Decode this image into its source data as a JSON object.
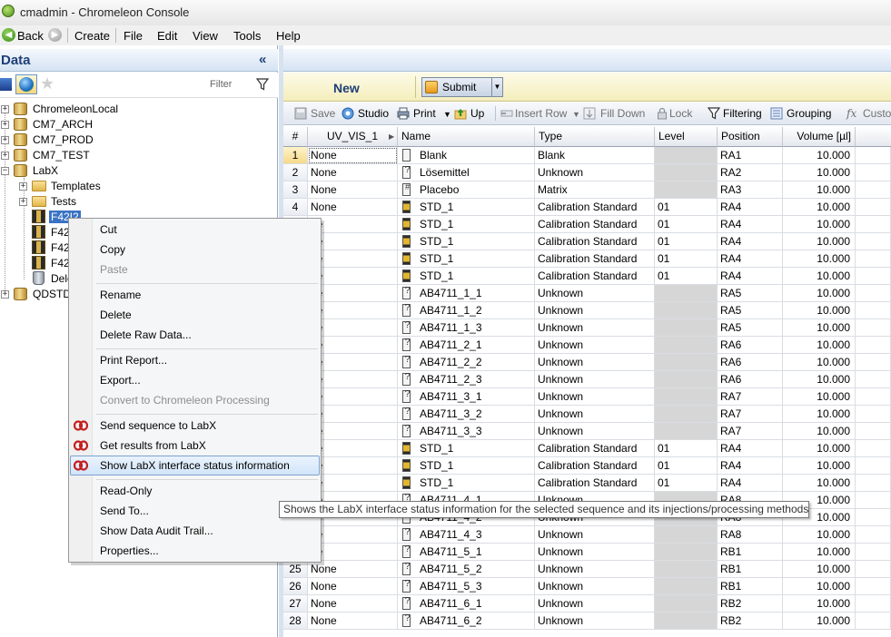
{
  "window": {
    "title": "cmadmin - Chromeleon Console"
  },
  "menubar": {
    "back_label": "Back",
    "items": [
      "Create",
      "File",
      "Edit",
      "View",
      "Tools",
      "Help"
    ]
  },
  "left_pane": {
    "title": "Data",
    "collapse_glyph": "«",
    "filter_label": "Filter",
    "tree": [
      {
        "label": "ChromeleonLocal"
      },
      {
        "label": "CM7_ARCH"
      },
      {
        "label": "CM7_PROD"
      },
      {
        "label": "CM7_TEST"
      },
      {
        "label": "LabX"
      },
      {
        "label": "Templates"
      },
      {
        "label": "Tests"
      },
      {
        "label": "F42I2"
      },
      {
        "label": "F42"
      },
      {
        "label": "F42"
      },
      {
        "label": "F42"
      },
      {
        "label": "Dele"
      },
      {
        "label": "QDSTD"
      }
    ]
  },
  "right_pane": {
    "new_label": "New",
    "submit_label": "Submit",
    "toolbar": {
      "save": "Save",
      "studio": "Studio",
      "print": "Print",
      "up": "Up",
      "insert_row": "Insert Row",
      "fill_down": "Fill Down",
      "lock": "Lock",
      "filtering": "Filtering",
      "grouping": "Grouping",
      "custom": "Custo"
    },
    "columns": [
      "#",
      "UV_VIS_1",
      "Name",
      "Type",
      "Level",
      "Position",
      "Volume [µl]"
    ],
    "rows": [
      {
        "n": "1",
        "uv": "None",
        "name": "Blank",
        "type": "Blank",
        "level": "",
        "pos": "RA1",
        "vol": "10.000",
        "kind": "blank"
      },
      {
        "n": "2",
        "uv": "None",
        "name": "Lösemittel",
        "type": "Unknown",
        "level": "",
        "pos": "RA2",
        "vol": "10.000",
        "kind": "unk"
      },
      {
        "n": "3",
        "uv": "None",
        "name": "Placebo",
        "type": "Matrix",
        "level": "",
        "pos": "RA3",
        "vol": "10.000",
        "kind": "mat"
      },
      {
        "n": "4",
        "uv": "None",
        "name": "STD_1",
        "type": "Calibration Standard",
        "level": "01",
        "pos": "RA4",
        "vol": "10.000",
        "kind": "std"
      },
      {
        "n": "",
        "uv": "ne",
        "name": "STD_1",
        "type": "Calibration Standard",
        "level": "01",
        "pos": "RA4",
        "vol": "10.000",
        "kind": "std"
      },
      {
        "n": "",
        "uv": "ne",
        "name": "STD_1",
        "type": "Calibration Standard",
        "level": "01",
        "pos": "RA4",
        "vol": "10.000",
        "kind": "std"
      },
      {
        "n": "",
        "uv": "ne",
        "name": "STD_1",
        "type": "Calibration Standard",
        "level": "01",
        "pos": "RA4",
        "vol": "10.000",
        "kind": "std"
      },
      {
        "n": "",
        "uv": "ne",
        "name": "STD_1",
        "type": "Calibration Standard",
        "level": "01",
        "pos": "RA4",
        "vol": "10.000",
        "kind": "std"
      },
      {
        "n": "",
        "uv": "ne",
        "name": "AB4711_1_1",
        "type": "Unknown",
        "level": "",
        "pos": "RA5",
        "vol": "10.000",
        "kind": "unk"
      },
      {
        "n": "",
        "uv": "ne",
        "name": "AB4711_1_2",
        "type": "Unknown",
        "level": "",
        "pos": "RA5",
        "vol": "10.000",
        "kind": "unk"
      },
      {
        "n": "",
        "uv": "ne",
        "name": "AB4711_1_3",
        "type": "Unknown",
        "level": "",
        "pos": "RA5",
        "vol": "10.000",
        "kind": "unk"
      },
      {
        "n": "",
        "uv": "ne",
        "name": "AB4711_2_1",
        "type": "Unknown",
        "level": "",
        "pos": "RA6",
        "vol": "10.000",
        "kind": "unk"
      },
      {
        "n": "",
        "uv": "ne",
        "name": "AB4711_2_2",
        "type": "Unknown",
        "level": "",
        "pos": "RA6",
        "vol": "10.000",
        "kind": "unk"
      },
      {
        "n": "",
        "uv": "ne",
        "name": "AB4711_2_3",
        "type": "Unknown",
        "level": "",
        "pos": "RA6",
        "vol": "10.000",
        "kind": "unk"
      },
      {
        "n": "",
        "uv": "ne",
        "name": "AB4711_3_1",
        "type": "Unknown",
        "level": "",
        "pos": "RA7",
        "vol": "10.000",
        "kind": "unk"
      },
      {
        "n": "",
        "uv": "ne",
        "name": "AB4711_3_2",
        "type": "Unknown",
        "level": "",
        "pos": "RA7",
        "vol": "10.000",
        "kind": "unk"
      },
      {
        "n": "",
        "uv": "ne",
        "name": "AB4711_3_3",
        "type": "Unknown",
        "level": "",
        "pos": "RA7",
        "vol": "10.000",
        "kind": "unk"
      },
      {
        "n": "",
        "uv": "ne",
        "name": "STD_1",
        "type": "Calibration Standard",
        "level": "01",
        "pos": "RA4",
        "vol": "10.000",
        "kind": "std"
      },
      {
        "n": "",
        "uv": "ne",
        "name": "STD_1",
        "type": "Calibration Standard",
        "level": "01",
        "pos": "RA4",
        "vol": "10.000",
        "kind": "std"
      },
      {
        "n": "",
        "uv": "ne",
        "name": "STD_1",
        "type": "Calibration Standard",
        "level": "01",
        "pos": "RA4",
        "vol": "10.000",
        "kind": "std"
      },
      {
        "n": "",
        "uv": "ne",
        "name": "AB4711_4_1",
        "type": "Unknown",
        "level": "",
        "pos": "RA8",
        "vol": "10.000",
        "kind": "unk"
      },
      {
        "n": "",
        "uv": "ne",
        "name": "AB4711_4_2",
        "type": "Unknown",
        "level": "",
        "pos": "RA8",
        "vol": "10.000",
        "kind": "unk"
      },
      {
        "n": "",
        "uv": "ne",
        "name": "AB4711_4_3",
        "type": "Unknown",
        "level": "",
        "pos": "RA8",
        "vol": "10.000",
        "kind": "unk"
      },
      {
        "n": "",
        "uv": "ne",
        "name": "AB4711_5_1",
        "type": "Unknown",
        "level": "",
        "pos": "RB1",
        "vol": "10.000",
        "kind": "unk"
      },
      {
        "n": "25",
        "uv": "None",
        "name": "AB4711_5_2",
        "type": "Unknown",
        "level": "",
        "pos": "RB1",
        "vol": "10.000",
        "kind": "unk"
      },
      {
        "n": "26",
        "uv": "None",
        "name": "AB4711_5_3",
        "type": "Unknown",
        "level": "",
        "pos": "RB1",
        "vol": "10.000",
        "kind": "unk"
      },
      {
        "n": "27",
        "uv": "None",
        "name": "AB4711_6_1",
        "type": "Unknown",
        "level": "",
        "pos": "RB2",
        "vol": "10.000",
        "kind": "unk"
      },
      {
        "n": "28",
        "uv": "None",
        "name": "AB4711_6_2",
        "type": "Unknown",
        "level": "",
        "pos": "RB2",
        "vol": "10.000",
        "kind": "unk"
      }
    ]
  },
  "context_menu": {
    "items": [
      {
        "label": "Cut",
        "enabled": true
      },
      {
        "label": "Copy",
        "enabled": true
      },
      {
        "label": "Paste",
        "enabled": false
      },
      {
        "label": "Rename",
        "enabled": true
      },
      {
        "label": "Delete",
        "enabled": true
      },
      {
        "label": "Delete Raw Data...",
        "enabled": true
      },
      {
        "label": "Print Report...",
        "enabled": true
      },
      {
        "label": "Export...",
        "enabled": true
      },
      {
        "label": "Convert to Chromeleon Processing",
        "enabled": false
      },
      {
        "label": "Send sequence to LabX",
        "enabled": true
      },
      {
        "label": "Get results from LabX",
        "enabled": true
      },
      {
        "label": "Show LabX interface status information",
        "enabled": true,
        "highlighted": true
      },
      {
        "label": "Read-Only",
        "enabled": true
      },
      {
        "label": "Send To...",
        "enabled": true
      },
      {
        "label": "Show Data Audit Trail...",
        "enabled": true
      },
      {
        "label": "Properties...",
        "enabled": true
      }
    ]
  },
  "tooltip": {
    "text": "Shows the LabX interface status information for the selected sequence and its injections/processing methods"
  },
  "colors": {
    "accent": "#1e3f78",
    "selection": "#3a72c4",
    "labx_icon": "#c41e1e"
  }
}
